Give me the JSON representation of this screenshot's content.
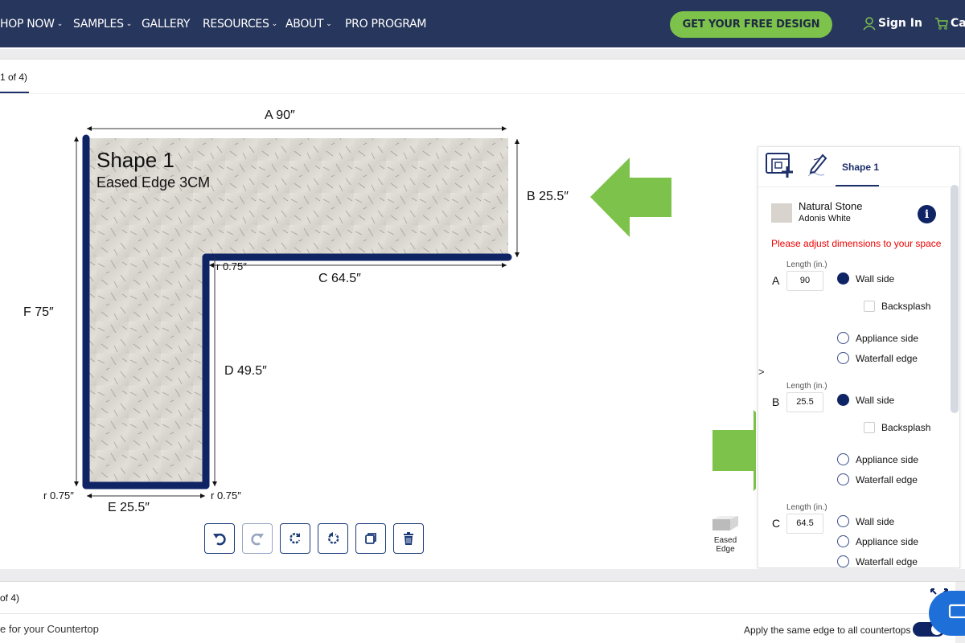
{
  "nav": {
    "items": [
      {
        "label": "HOP NOW",
        "dropdown": true
      },
      {
        "label": "SAMPLES",
        "dropdown": true
      },
      {
        "label": "GALLERY",
        "dropdown": false
      },
      {
        "label": "RESOURCES",
        "dropdown": true
      },
      {
        "label": "ABOUT",
        "dropdown": true
      },
      {
        "label": "PRO PROGRAM",
        "dropdown": false
      }
    ],
    "cta_label": "GET YOUR FREE DESIGN",
    "signin_label": "Sign In",
    "cart_label": "Ca"
  },
  "section1": {
    "tab_label": "1 of 4)"
  },
  "drawing": {
    "shape_title": "Shape 1",
    "shape_subtitle": "Eased Edge 3CM",
    "dims": {
      "A": "A  90″",
      "B": "B  25.5″",
      "C": "C  64.5″",
      "D": "D  49.5″",
      "E": "E  25.5″",
      "F": "F  75″",
      "r_inner": "r 0.75″",
      "r_bottom_left": "r 0.75″",
      "r_bottom_right": "r 0.75″"
    },
    "edge_color": "#0f2464",
    "arrow_color": "#7dc24b"
  },
  "tools": [
    "undo",
    "redo",
    "rotate-clockwise",
    "rotate-counterclockwise",
    "duplicate",
    "delete"
  ],
  "edge_preview": {
    "label_line1": "Eased",
    "label_line2": "Edge"
  },
  "panel": {
    "tab_label": "Shape 1",
    "material_type": "Natural Stone",
    "material_name": "Adonis White",
    "warning": "Please adjust dimensions to your space",
    "length_label": "Length (in.)",
    "sides": [
      {
        "letter": "A",
        "length": "90",
        "wall_side": true,
        "backsplash": false,
        "options": [
          "Wall side",
          "Backsplash",
          "Appliance side",
          "Waterfall edge"
        ]
      },
      {
        "letter": "B",
        "length": "25.5",
        "wall_side": true,
        "backsplash": false,
        "options": [
          "Wall side",
          "Backsplash",
          "Appliance side",
          "Waterfall edge"
        ]
      },
      {
        "letter": "C",
        "length": "64.5",
        "wall_side": false,
        "options": [
          "Wall side",
          "Appliance side",
          "Waterfall edge"
        ]
      }
    ]
  },
  "section2": {
    "label": "of 4)"
  },
  "section3": {
    "label": "e for your Countertop",
    "apply_label": "Apply the same edge to all countertops",
    "apply_on": true
  }
}
